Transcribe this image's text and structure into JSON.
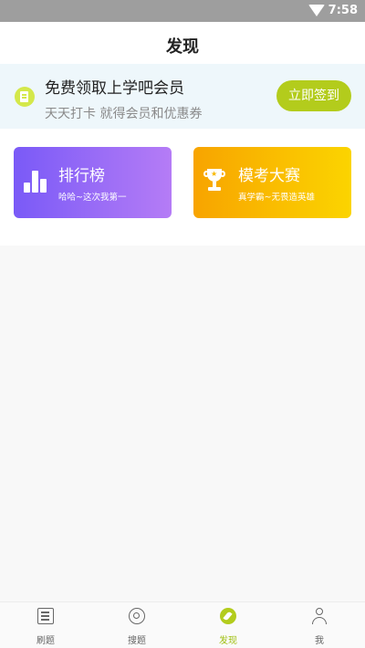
{
  "status_bar": {
    "time": "7:58"
  },
  "header": {
    "title": "发现"
  },
  "banner": {
    "main_text": "免费领取上学吧会员",
    "sub_text": "天天打卡 就得会员和优惠券",
    "button_label": "立即签到"
  },
  "cards": [
    {
      "label": "排行榜",
      "desc": "哈哈~这次我第一",
      "icon": "bar-chart-icon"
    },
    {
      "label": "模考大赛",
      "desc": "真学霸~无畏造英雄",
      "icon": "trophy-icon"
    }
  ],
  "tabbar": {
    "active": "发现",
    "items": [
      {
        "label": "刷题",
        "icon": "list-icon"
      },
      {
        "label": "搜题",
        "icon": "search-icon"
      },
      {
        "label": "发现",
        "icon": "compass-icon"
      },
      {
        "label": "我",
        "icon": "user-icon"
      }
    ]
  },
  "colors": {
    "accent": "#b3cc1c",
    "rank_gradient": [
      "#7a5af7",
      "#b57cf6"
    ],
    "exam_gradient": [
      "#f8a400",
      "#fbd400"
    ],
    "banner_bg": "#eef7fb"
  }
}
